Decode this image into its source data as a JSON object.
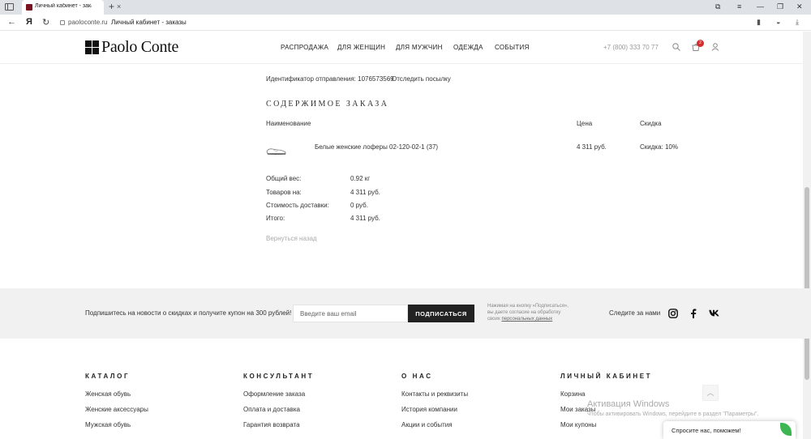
{
  "browser": {
    "tab_title": "Личный кабинет - заказ",
    "new_tab": "+",
    "yandex_logo": "Я",
    "url_host": "paoloconte.ru",
    "url_title": "Личный кабинет - заказы"
  },
  "header": {
    "logo_text": "Paolo Conte",
    "nav": [
      "РАСПРОДАЖА",
      "ДЛЯ ЖЕНЩИН",
      "ДЛЯ МУЖЧИН",
      "ОДЕЖДА",
      "СОБЫТИЯ"
    ],
    "phone": "+7 (800) 333 70 77",
    "cart_count": "2"
  },
  "order": {
    "tracking_label": "Идентификатор отправления: 1076573569",
    "track_link": "Отследить посылку",
    "section_title": "СОДЕРЖИМОЕ ЗАКАЗА",
    "columns": [
      "Наименование",
      "Цена",
      "Скидка"
    ],
    "item": {
      "name": "Белые женские лоферы 02-120-02-1 (37)",
      "price": "4 311 руб.",
      "discount": "Скидка: 10%"
    },
    "summary": [
      {
        "label": "Общий вес:",
        "value": "0.92 кг"
      },
      {
        "label": "Товаров на:",
        "value": "4 311 руб."
      },
      {
        "label": "Стоимость доставки:",
        "value": "0 руб."
      },
      {
        "label": "Итого:",
        "value": "4 311 руб."
      }
    ],
    "back_link": "Вернуться назад"
  },
  "newsletter": {
    "text": "Подпишитесь на новости о скидках и получите купон на 300 рублей!",
    "placeholder": "Введите ваш email",
    "button": "ПОДПИСАТЬСЯ",
    "consent_1": "Нажимая на кнопку «Подписаться»,",
    "consent_2": "вы даете согласие на обработку",
    "consent_3a": "своих ",
    "consent_3b": "персональных данных",
    "follow": "Следите за нами",
    "social": [
      "instagram",
      "facebook",
      "vk"
    ]
  },
  "footer": {
    "columns": [
      {
        "title": "КАТАЛОГ",
        "links": [
          "Женская обувь",
          "Женские аксессуары",
          "Мужская обувь"
        ]
      },
      {
        "title": "КОНСУЛЬТАНТ",
        "links": [
          "Оформление заказа",
          "Оплата и доставка",
          "Гарантия возврата"
        ]
      },
      {
        "title": "О НАС",
        "links": [
          "Контакты и реквизиты",
          "История компании",
          "Акции и события"
        ]
      },
      {
        "title": "ЛИЧНЫЙ КАБИНЕТ",
        "links": [
          "Корзина",
          "Мои заказы",
          "Мои купоны"
        ]
      }
    ]
  },
  "overlay": {
    "activation_title": "Активация Windows",
    "activation_text": "Чтобы активировать Windows, перейдите в раздел \"Параметры\".",
    "chat_label": "Спросите нас, поможем!"
  },
  "colors": {
    "accent_dark": "#222222",
    "badge_red": "#d62b2b",
    "tab_favicon": "#7a1120",
    "chat_green": "#3cb651"
  }
}
